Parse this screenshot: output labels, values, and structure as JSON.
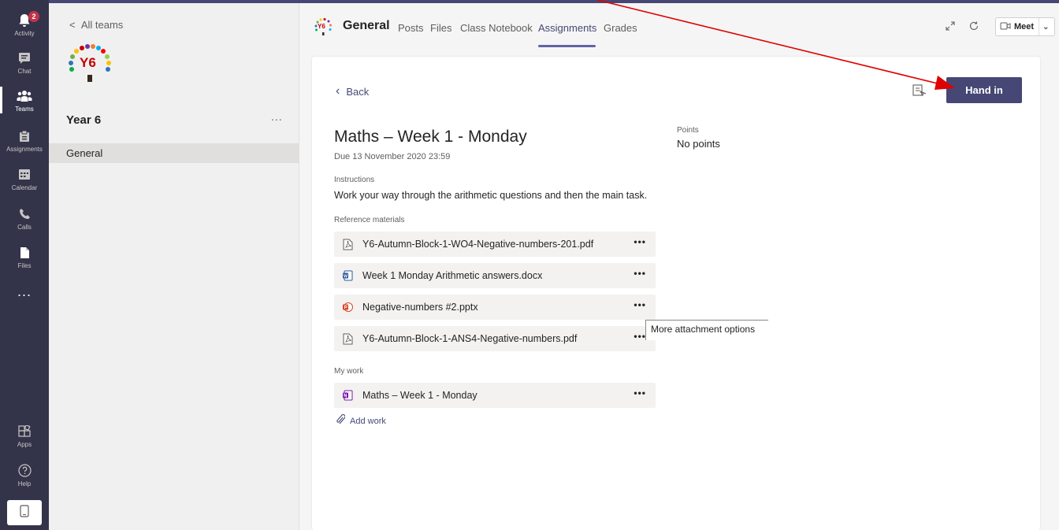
{
  "rail": {
    "items": [
      {
        "label": "Activity",
        "icon": "bell-icon",
        "badge": "2"
      },
      {
        "label": "Chat",
        "icon": "chat-icon"
      },
      {
        "label": "Teams",
        "icon": "teams-icon"
      },
      {
        "label": "Assignments",
        "icon": "assignments-icon"
      },
      {
        "label": "Calendar",
        "icon": "calendar-icon"
      },
      {
        "label": "Calls",
        "icon": "phone-icon"
      },
      {
        "label": "Files",
        "icon": "file-icon"
      }
    ],
    "more": "...",
    "apps_label": "Apps",
    "help_label": "Help"
  },
  "team": {
    "back_label": "All teams",
    "logo_text": "Y6",
    "name": "Year 6",
    "more": "...",
    "channels": [
      "General"
    ]
  },
  "header": {
    "channel_avatar": "Y6",
    "channel_name": "General",
    "tabs": [
      "Posts",
      "Files",
      "Class Notebook",
      "Assignments",
      "Grades"
    ],
    "active_tab": "Assignments",
    "meet_label": "Meet"
  },
  "assignment": {
    "back_label": "Back",
    "hand_in_label": "Hand in",
    "title": "Maths – Week 1 - Monday",
    "due": "Due 13 November 2020 23:59",
    "points_label": "Points",
    "points_value": "No points",
    "instructions_label": "Instructions",
    "instructions_text": "Work your way through the arithmetic questions and then the main task.",
    "reference_label": "Reference materials",
    "reference_files": [
      {
        "name": "Y6-Autumn-Block-1-WO4-Negative-numbers-201.pdf",
        "type": "pdf"
      },
      {
        "name": "Week 1 Monday Arithmetic answers.docx",
        "type": "docx"
      },
      {
        "name": "Negative-numbers #2.pptx",
        "type": "pptx"
      },
      {
        "name": "Y6-Autumn-Block-1-ANS4-Negative-numbers.pdf",
        "type": "pdf"
      }
    ],
    "my_work_label": "My work",
    "my_work_files": [
      {
        "name": "Maths – Week 1 - Monday",
        "type": "onenote"
      }
    ],
    "add_work_label": "Add work",
    "more_dots": "•••",
    "tooltip": "More attachment options"
  },
  "colors": {
    "rail": "#33344a",
    "brand": "#464775",
    "accent": "#6264a7",
    "annotation_arrow": "#e00000"
  }
}
